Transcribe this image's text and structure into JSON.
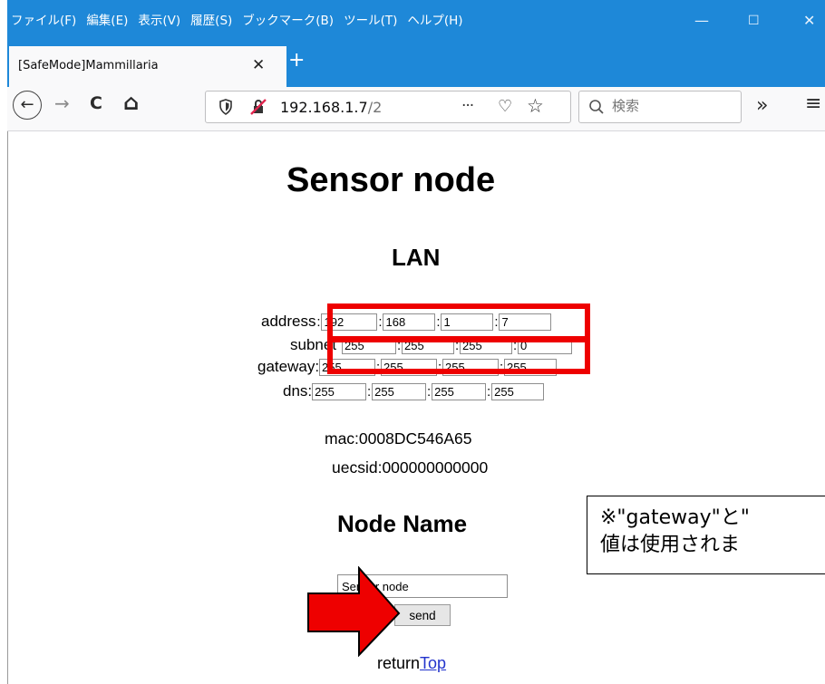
{
  "menubar": {
    "items": [
      "ファイル(F)",
      "編集(E)",
      "表示(V)",
      "履歴(S)",
      "ブックマーク(B)",
      "ツール(T)",
      "ヘルプ(H)"
    ],
    "minimize": "—",
    "maximize": "☐",
    "close": "✕"
  },
  "tab": {
    "title": "[SafeMode]Mammillaria",
    "close": "✕",
    "new_tab": "+"
  },
  "navbar": {
    "back_icon": "←",
    "forward_icon": "→",
    "reload_icon": "C",
    "home_icon": "⌂",
    "url_host": "192.168.1.7",
    "url_path": "/2",
    "menu_dots": "···",
    "pocket_icon": "♡",
    "star_icon": "☆",
    "search_placeholder": "検索",
    "overflow": "»",
    "hamburger": "≡"
  },
  "page": {
    "title": "Sensor node",
    "lan_heading": "LAN",
    "address": {
      "label": "address",
      "values": [
        "192",
        "168",
        "1",
        "7"
      ]
    },
    "subnet": {
      "label": "subnet",
      "values": [
        "255",
        "255",
        "255",
        "0"
      ]
    },
    "gateway": {
      "label": "gateway:",
      "values": [
        "255",
        "255",
        "255",
        "255"
      ]
    },
    "dns": {
      "label": "dns:",
      "values": [
        "255",
        "255",
        "255",
        "255"
      ]
    },
    "mac": "mac:0008DC546A65",
    "uecsid": "uecsid:000000000000",
    "nodename_heading": "Node Name",
    "nodename_value": "Sensor node",
    "send_label": "send",
    "return_text": "return",
    "return_link": "Top"
  },
  "annotation": {
    "note_line1": "※\"gateway\"と\"",
    "note_line2": "値は使用されま",
    "colors": {
      "highlight": "#ee0000",
      "titlebar": "#1e88d8"
    }
  }
}
